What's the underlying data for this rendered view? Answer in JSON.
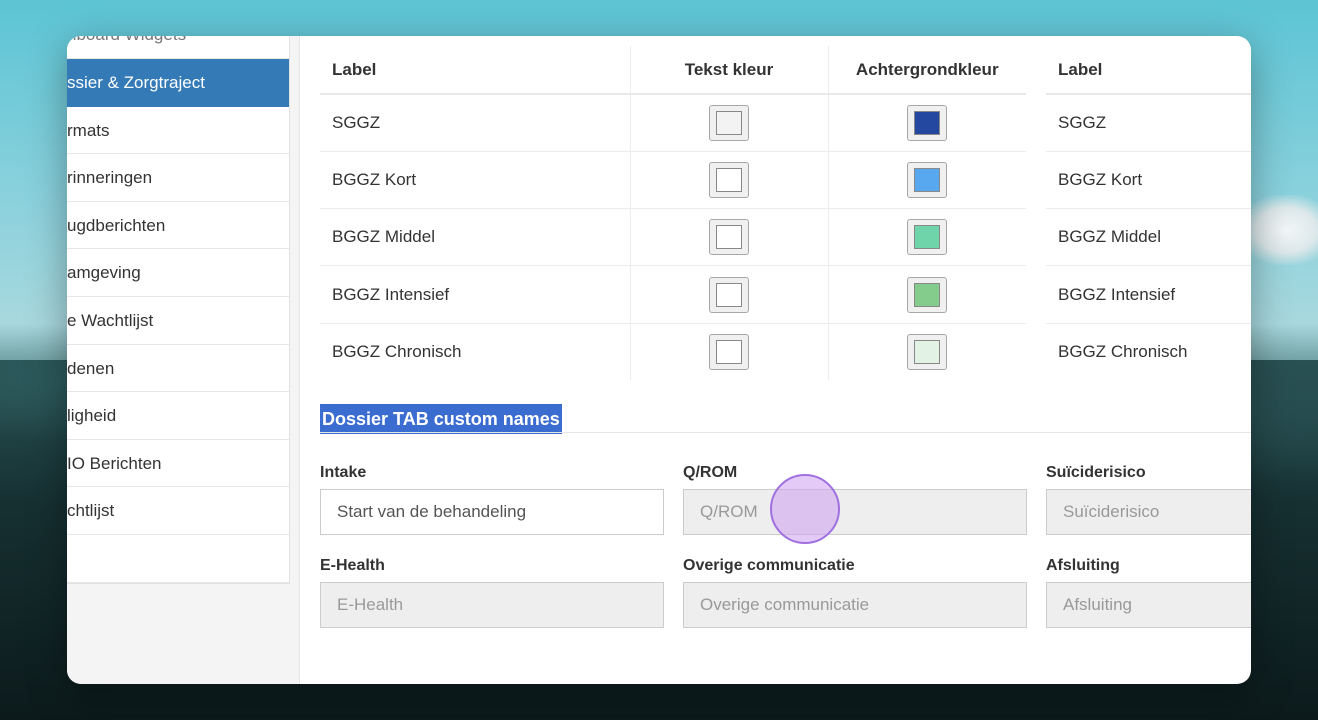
{
  "sidebar": {
    "items": [
      {
        "label": "hboard Widgets"
      },
      {
        "label": "ssier & Zorgtraject"
      },
      {
        "label": "rmats"
      },
      {
        "label": "rinneringen"
      },
      {
        "label": "ugdberichten"
      },
      {
        "label": "amgeving"
      },
      {
        "label": "e Wachtlijst"
      },
      {
        "label": "denen"
      },
      {
        "label": "ligheid"
      },
      {
        "label": "IO Berichten"
      },
      {
        "label": "chtlijst"
      }
    ],
    "active_index": 1
  },
  "color_table": {
    "headers": {
      "label": "Label",
      "text_color": "Tekst kleur",
      "bg_color": "Achtergrondkleur"
    },
    "rows": [
      {
        "label": "SGGZ",
        "text_color": "#f3f3f3",
        "bg_color": "#2448a0"
      },
      {
        "label": "BGGZ Kort",
        "text_color": "#ffffff",
        "bg_color": "#58a8f0"
      },
      {
        "label": "BGGZ Middel",
        "text_color": "#ffffff",
        "bg_color": "#6fd4aa"
      },
      {
        "label": "BGGZ Intensief",
        "text_color": "#ffffff",
        "bg_color": "#84cc8c"
      },
      {
        "label": "BGGZ Chronisch",
        "text_color": "#ffffff",
        "bg_color": "#e2f2e4"
      }
    ]
  },
  "color_table_2": {
    "header_label": "Label",
    "rows": [
      "SGGZ",
      "BGGZ Kort",
      "BGGZ Middel",
      "BGGZ Intensief",
      "BGGZ Chronisch"
    ]
  },
  "section": {
    "title": "Dossier TAB custom names"
  },
  "fields": {
    "intake": {
      "label": "Intake",
      "value": "Start van de behandeling"
    },
    "qrom": {
      "label": "Q/ROM",
      "placeholder": "Q/ROM"
    },
    "suicide": {
      "label": "Suïciderisico",
      "placeholder": "Suïciderisico"
    },
    "ehealth": {
      "label": "E-Health",
      "placeholder": "E-Health"
    },
    "overige": {
      "label": "Overige communicatie",
      "placeholder": "Overige communicatie"
    },
    "afsluiting": {
      "label": "Afsluiting",
      "placeholder": "Afsluiting"
    }
  },
  "colors": {
    "accent": "#337ab7",
    "highlight": "#3b6cd0"
  }
}
